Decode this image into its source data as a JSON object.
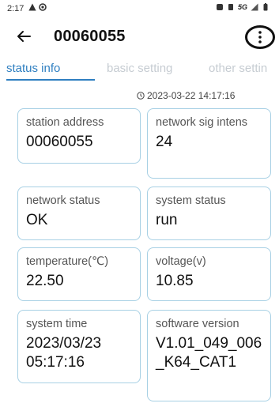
{
  "status_bar": {
    "time": "2:17",
    "network": "5G"
  },
  "app_bar": {
    "title": "00060055"
  },
  "tabs": [
    {
      "label": "status info"
    },
    {
      "label": "basic setting"
    },
    {
      "label": "other settin"
    }
  ],
  "timestamp": "2023-03-22 14:17:16",
  "cards": [
    {
      "label": "station address",
      "value": "00060055"
    },
    {
      "label": "network sig intens",
      "value": "24"
    },
    {
      "label": "network status",
      "value": "OK"
    },
    {
      "label": "system status",
      "value": "run"
    },
    {
      "label": "temperature(℃)",
      "value": "22.50"
    },
    {
      "label": "voltage(v)",
      "value": "10.85"
    },
    {
      "label": "system time",
      "value": "2023/03/23 05:17:16"
    },
    {
      "label": "software version",
      "value": "V1.01_049_006_K64_CAT1"
    }
  ],
  "colors": {
    "accent": "#2f7fc1",
    "card_border": "#a7d0e4",
    "inactive_tab": "#c6ccd2"
  }
}
